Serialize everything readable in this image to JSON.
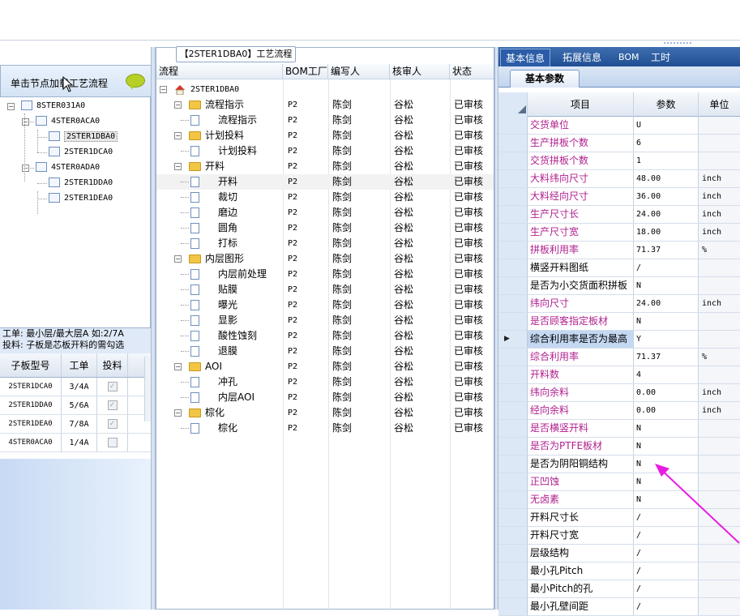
{
  "left": {
    "hint": "单击节点加载工艺流程",
    "tree": [
      {
        "label": "8STER031A0",
        "level": 0
      },
      {
        "label": "4STER0ACA0",
        "level": 1
      },
      {
        "label": "2STER1DBA0",
        "level": 2,
        "selected": true
      },
      {
        "label": "2STER1DCA0",
        "level": 2
      },
      {
        "label": "4STER0ADA0",
        "level": 1
      },
      {
        "label": "2STER1DDA0",
        "level": 2
      },
      {
        "label": "2STER1DEA0",
        "level": 2
      }
    ],
    "note_line1": "工单: 最小层/最大层A 如:2/7A",
    "note_line2": "投料: 子板是芯板开料的需勾选",
    "subgrid": {
      "headers": [
        "子板型号",
        "工单",
        "投料"
      ],
      "rows": [
        {
          "model": "2STER1DCA0",
          "order": "3/4A",
          "feed": "✓"
        },
        {
          "model": "2STER1DDA0",
          "order": "5/6A",
          "feed": "✓"
        },
        {
          "model": "2STER1DEA0",
          "order": "7/8A",
          "feed": "✓"
        },
        {
          "model": "4STER0ACA0",
          "order": "1/4A",
          "feed": ""
        }
      ]
    }
  },
  "middle": {
    "title": "【2STER1DBA0】工艺流程",
    "headers": [
      "流程",
      "BOM工厂",
      "编写人",
      "核审人",
      "状态"
    ],
    "root": "2STER1DBA0",
    "rows": [
      {
        "name": "流程指示",
        "type": "folder",
        "factory": "P2",
        "writer": "陈剑",
        "reviewer": "谷松",
        "status": "已审核"
      },
      {
        "name": "流程指示",
        "type": "doc",
        "factory": "P2",
        "writer": "陈剑",
        "reviewer": "谷松",
        "status": "已审核"
      },
      {
        "name": "计划投料",
        "type": "folder",
        "factory": "P2",
        "writer": "陈剑",
        "reviewer": "谷松",
        "status": "已审核"
      },
      {
        "name": "计划投料",
        "type": "doc",
        "factory": "P2",
        "writer": "陈剑",
        "reviewer": "谷松",
        "status": "已审核"
      },
      {
        "name": "开料",
        "type": "folder",
        "factory": "P2",
        "writer": "陈剑",
        "reviewer": "谷松",
        "status": "已审核"
      },
      {
        "name": "开料",
        "type": "doc",
        "factory": "P2",
        "writer": "陈剑",
        "reviewer": "谷松",
        "status": "已审核",
        "highlight": true
      },
      {
        "name": "裁切",
        "type": "doc",
        "factory": "P2",
        "writer": "陈剑",
        "reviewer": "谷松",
        "status": "已审核"
      },
      {
        "name": "磨边",
        "type": "doc",
        "factory": "P2",
        "writer": "陈剑",
        "reviewer": "谷松",
        "status": "已审核"
      },
      {
        "name": "圆角",
        "type": "doc",
        "factory": "P2",
        "writer": "陈剑",
        "reviewer": "谷松",
        "status": "已审核"
      },
      {
        "name": "打标",
        "type": "doc",
        "factory": "P2",
        "writer": "陈剑",
        "reviewer": "谷松",
        "status": "已审核"
      },
      {
        "name": "内层图形",
        "type": "folder",
        "factory": "P2",
        "writer": "陈剑",
        "reviewer": "谷松",
        "status": "已审核"
      },
      {
        "name": "内层前处理",
        "type": "doc",
        "factory": "P2",
        "writer": "陈剑",
        "reviewer": "谷松",
        "status": "已审核"
      },
      {
        "name": "贴膜",
        "type": "doc",
        "factory": "P2",
        "writer": "陈剑",
        "reviewer": "谷松",
        "status": "已审核"
      },
      {
        "name": "曝光",
        "type": "doc",
        "factory": "P2",
        "writer": "陈剑",
        "reviewer": "谷松",
        "status": "已审核"
      },
      {
        "name": "显影",
        "type": "doc",
        "factory": "P2",
        "writer": "陈剑",
        "reviewer": "谷松",
        "status": "已审核"
      },
      {
        "name": "酸性蚀刻",
        "type": "doc",
        "factory": "P2",
        "writer": "陈剑",
        "reviewer": "谷松",
        "status": "已审核"
      },
      {
        "name": "退膜",
        "type": "doc",
        "factory": "P2",
        "writer": "陈剑",
        "reviewer": "谷松",
        "status": "已审核"
      },
      {
        "name": "AOI",
        "type": "folder",
        "factory": "P2",
        "writer": "陈剑",
        "reviewer": "谷松",
        "status": "已审核"
      },
      {
        "name": "冲孔",
        "type": "doc",
        "factory": "P2",
        "writer": "陈剑",
        "reviewer": "谷松",
        "status": "已审核"
      },
      {
        "name": "内层AOI",
        "type": "doc",
        "factory": "P2",
        "writer": "陈剑",
        "reviewer": "谷松",
        "status": "已审核"
      },
      {
        "name": "棕化",
        "type": "folder",
        "factory": "P2",
        "writer": "陈剑",
        "reviewer": "谷松",
        "status": "已审核"
      },
      {
        "name": "棕化",
        "type": "doc",
        "factory": "P2",
        "writer": "陈剑",
        "reviewer": "谷松",
        "status": "已审核"
      }
    ]
  },
  "right": {
    "tabs": [
      "基本信息",
      "拓展信息",
      "BOM",
      "工时"
    ],
    "subtab": "基本参数",
    "headers": [
      "项目",
      "参数",
      "单位"
    ],
    "params": [
      {
        "name": "交货单位",
        "value": "U",
        "unit": "",
        "purple": true
      },
      {
        "name": "生产拼板个数",
        "value": "6",
        "unit": "",
        "purple": true
      },
      {
        "name": "交货拼板个数",
        "value": "1",
        "unit": "",
        "purple": true
      },
      {
        "name": "大料纬向尺寸",
        "value": "48.00",
        "unit": "inch",
        "purple": true
      },
      {
        "name": "大料经向尺寸",
        "value": "36.00",
        "unit": "inch",
        "purple": true
      },
      {
        "name": "生产尺寸长",
        "value": "24.00",
        "unit": "inch",
        "purple": true
      },
      {
        "name": "生产尺寸宽",
        "value": "18.00",
        "unit": "inch",
        "purple": true
      },
      {
        "name": "拼板利用率",
        "value": "71.37",
        "unit": "%",
        "purple": true
      },
      {
        "name": "横竖开料图纸",
        "value": "/",
        "unit": "",
        "purple": false
      },
      {
        "name": "是否为小交货面积拼板",
        "value": "N",
        "unit": "",
        "purple": false
      },
      {
        "name": "纬向尺寸",
        "value": "24.00",
        "unit": "inch",
        "purple": true
      },
      {
        "name": "是否顾客指定板材",
        "value": "N",
        "unit": "",
        "purple": true
      },
      {
        "name": "综合利用率是否为最高",
        "value": "Y",
        "unit": "",
        "purple": false,
        "selected": true
      },
      {
        "name": "综合利用率",
        "value": "71.37",
        "unit": "%",
        "purple": true
      },
      {
        "name": "开料数",
        "value": "4",
        "unit": "",
        "purple": true
      },
      {
        "name": "纬向余料",
        "value": "0.00",
        "unit": "inch",
        "purple": true
      },
      {
        "name": "经向余料",
        "value": "0.00",
        "unit": "inch",
        "purple": true
      },
      {
        "name": "是否横竖开料",
        "value": "N",
        "unit": "",
        "purple": true
      },
      {
        "name": "是否为PTFE板材",
        "value": "N",
        "unit": "",
        "purple": true
      },
      {
        "name": "是否为阴阳铜结构",
        "value": "N",
        "unit": "",
        "purple": false
      },
      {
        "name": "正凹蚀",
        "value": "N",
        "unit": "",
        "purple": true
      },
      {
        "name": "无卤素",
        "value": "N",
        "unit": "",
        "purple": true
      },
      {
        "name": "开料尺寸长",
        "value": "/",
        "unit": "",
        "purple": false
      },
      {
        "name": "开料尺寸宽",
        "value": "/",
        "unit": "",
        "purple": false
      },
      {
        "name": "层级结构",
        "value": "/",
        "unit": "",
        "purple": false
      },
      {
        "name": "最小孔Pitch",
        "value": "/",
        "unit": "",
        "purple": false
      },
      {
        "name": "最小Pitch的孔",
        "value": "/",
        "unit": "",
        "purple": false
      },
      {
        "name": "最小孔壁间距",
        "value": "/",
        "unit": "",
        "purple": false
      }
    ]
  },
  "colors": {
    "accent_purple": "#b0208f",
    "arrow_magenta": "#e81ce0",
    "tab_blue": "#1f4e93"
  }
}
